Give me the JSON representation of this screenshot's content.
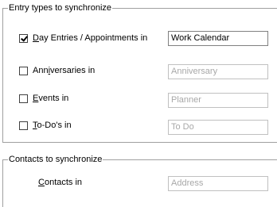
{
  "entry_group": {
    "title": "Entry types to synchronize",
    "rows": [
      {
        "checked": true,
        "label_mnemonic": "D",
        "label_rest": "ay Entries / Appointments in",
        "field_value": "Work Calendar"
      },
      {
        "checked": false,
        "label_pre": "Ann",
        "label_mnemonic": "i",
        "label_rest": "versaries in",
        "field_value": "Anniversary"
      },
      {
        "checked": false,
        "label_mnemonic": "E",
        "label_rest": "vents in",
        "field_value": "Planner"
      },
      {
        "checked": false,
        "label_mnemonic": "T",
        "label_rest": "o-Do's in",
        "field_value": "To Do"
      }
    ]
  },
  "contacts_group": {
    "title": "Contacts to synchronize",
    "label_mnemonic": "C",
    "label_rest": "ontacts in",
    "field_value": "Address"
  }
}
